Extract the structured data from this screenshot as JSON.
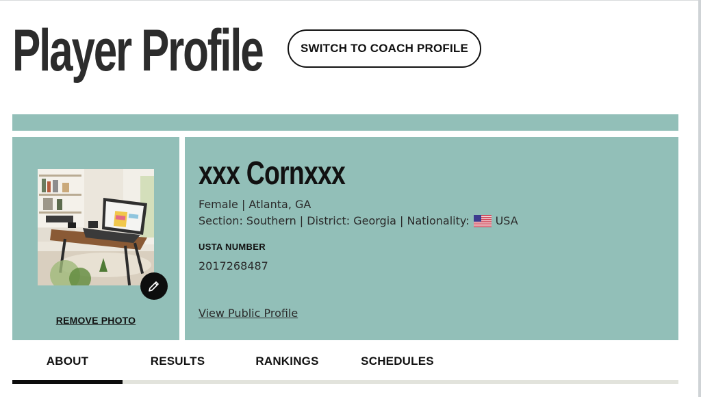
{
  "page": {
    "title": "Player Profile",
    "switch_button": "SWITCH TO COACH PROFILE"
  },
  "profile": {
    "name": "xxx Cornxxx",
    "gender_location": "Female | Atlanta, GA",
    "section_line_prefix": "Section: Southern | District: Georgia | Nationality:",
    "nationality_flag_icon": "us-flag-icon",
    "nationality": "USA",
    "usta_label": "USTA NUMBER",
    "usta_number": "2017268487",
    "public_profile_link": "View Public Profile",
    "remove_photo": "REMOVE PHOTO",
    "edit_icon": "pencil-icon"
  },
  "tabs": [
    {
      "label": "ABOUT",
      "active": true
    },
    {
      "label": "RESULTS",
      "active": false
    },
    {
      "label": "RANKINGS",
      "active": false
    },
    {
      "label": "SCHEDULES",
      "active": false
    }
  ],
  "colors": {
    "panel_teal": "#92bfb8",
    "active_tab": "#0d0d0d",
    "tab_track": "#e2e3dc"
  }
}
